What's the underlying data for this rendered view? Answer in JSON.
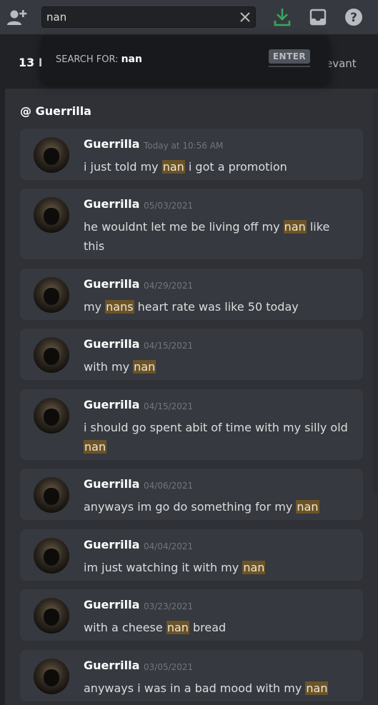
{
  "search": {
    "value": "nan",
    "suggestion_prefix": "SEARCH FOR:",
    "suggestion_term": "nan",
    "enter_key": "ENTER"
  },
  "results_header": {
    "count_text": "13 R",
    "sort_text": "evant"
  },
  "channel": {
    "label": "@ Guerrilla"
  },
  "results": [
    {
      "author": "Guerrilla",
      "timestamp": "Today at 10:56 AM",
      "parts": [
        "i just told my ",
        "nan",
        " i got a promotion"
      ]
    },
    {
      "author": "Guerrilla",
      "timestamp": "05/03/2021",
      "parts": [
        "he wouldnt let me be living off my ",
        "nan",
        " like this"
      ]
    },
    {
      "author": "Guerrilla",
      "timestamp": "04/29/2021",
      "parts": [
        "my ",
        "nans",
        " heart rate was like 50 today"
      ]
    },
    {
      "author": "Guerrilla",
      "timestamp": "04/15/2021",
      "parts": [
        "with my ",
        "nan",
        ""
      ]
    },
    {
      "author": "Guerrilla",
      "timestamp": "04/15/2021",
      "parts": [
        "i should go spent abit of time with my silly old ",
        "nan",
        ""
      ]
    },
    {
      "author": "Guerrilla",
      "timestamp": "04/06/2021",
      "parts": [
        "anyways im go do something for my ",
        "nan",
        ""
      ]
    },
    {
      "author": "Guerrilla",
      "timestamp": "04/04/2021",
      "parts": [
        "im just watching it with my ",
        "nan",
        ""
      ]
    },
    {
      "author": "Guerrilla",
      "timestamp": "03/23/2021",
      "parts": [
        "with a cheese ",
        "nan",
        " bread"
      ]
    },
    {
      "author": "Guerrilla",
      "timestamp": "03/05/2021",
      "parts": [
        "anyways i was in a bad mood with my ",
        "nan",
        ""
      ]
    }
  ],
  "colors": {
    "highlight": "#6b5427",
    "download_icon": "#3ba55d",
    "background": "#2f3136"
  },
  "icons": [
    "add-friend-icon",
    "close-icon",
    "download-icon",
    "inbox-icon",
    "help-icon"
  ]
}
